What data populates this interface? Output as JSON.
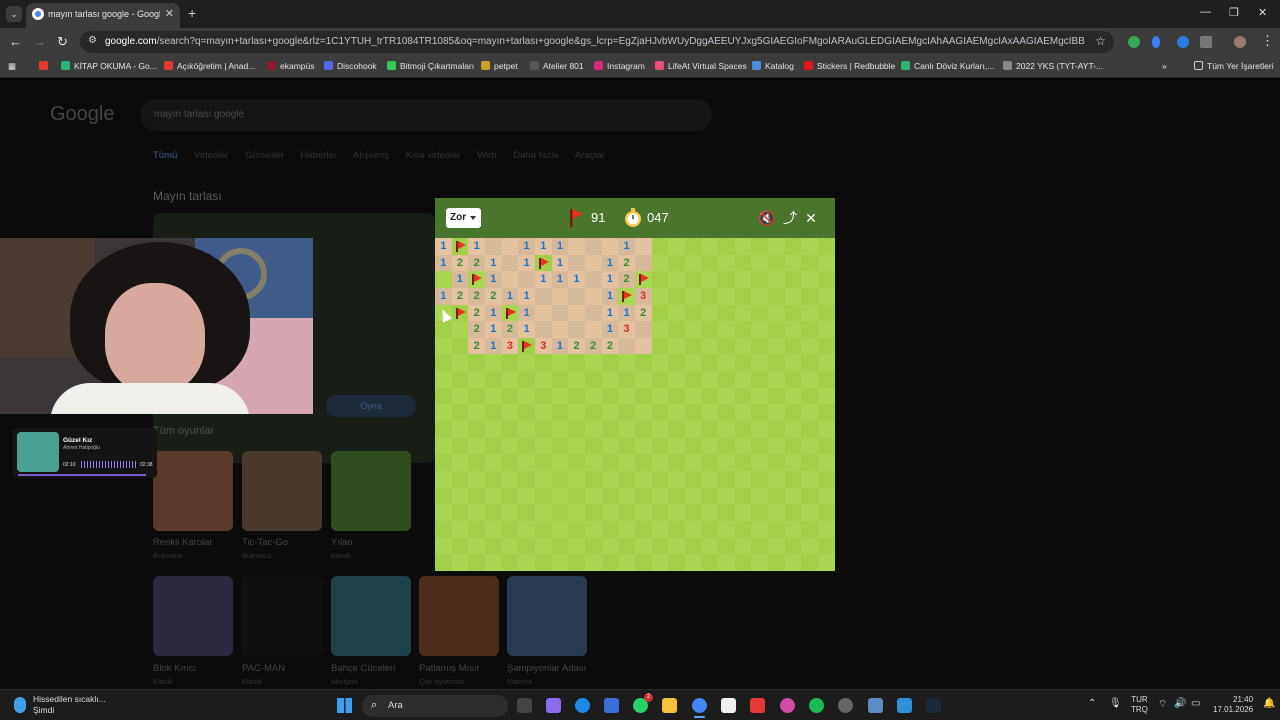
{
  "browser": {
    "tab_title": "mayın tarlası google - Google'da Ara",
    "url_host": "google.com",
    "url_rest": "/search?q=mayın+tarlası+google&rlz=1C1YTUH_trTR1084TR1085&oq=mayın+tarlası+google&gs_lcrp=EgZjaHJvbWUyDggAEEUYJxg5GIAEGIoFMgoIARAuGLEDGIAEMgcIAhAAGIAEMgcIAxAAGIAEMgcIBBAAGIAEMgcIBRAAGI..."
  },
  "bookmarks": [
    {
      "label": "KİTAP OKUMA - Go...",
      "color": "#e53935"
    },
    {
      "label": "Açıköğretim | Anad...",
      "color": "#e53935"
    },
    {
      "label": "ekampüs",
      "color": "#8e1f2a"
    },
    {
      "label": "Discohook",
      "color": "#5865f2"
    },
    {
      "label": "Bitmoji Çıkartmaları",
      "color": "#34c759"
    },
    {
      "label": "petpet",
      "color": "#c9a227"
    },
    {
      "label": "Atelier 801",
      "color": "#222222"
    },
    {
      "label": "Instagram",
      "color": "#d6297b"
    },
    {
      "label": "LifeAt Virtual Spaces",
      "color": "#e94e77"
    },
    {
      "label": "Katalog",
      "color": "#4a90d9"
    },
    {
      "label": "Stickers | Redbubble",
      "color": "#e41321"
    },
    {
      "label": "Canlı Döviz Kurları,...",
      "color": "#2bb673"
    },
    {
      "label": "2022 YKS (TYT-AYT-...",
      "color": "#888888"
    }
  ],
  "bookmarks_all": "Tüm Yer İşaretleri",
  "google": {
    "logo": "Google",
    "query": "mayın tarlası google",
    "tabs": [
      "Tümü",
      "Videolar",
      "Görseller",
      "Haberler",
      "Alışveriş",
      "Kısa videolar",
      "Web",
      "Daha fazla",
      "Araçlar"
    ],
    "section_title": "Mayın tarlası",
    "play_label": "Oyna",
    "all_games": "Tüm oyunlar",
    "games": [
      {
        "name": "Renkli Karolar",
        "sub": "Bulmaca",
        "color": "#5a3a2a"
      },
      {
        "name": "Tic-Tac-Go",
        "sub": "Bulmaca",
        "color": "#4a3a2e"
      },
      {
        "name": "Yılan",
        "sub": "Klasik",
        "color": "#2f4d1f"
      },
      {
        "name": "Blok Kırıcı",
        "sub": "Klasik",
        "color": "#2e2740"
      },
      {
        "name": "PAC-MAN",
        "sub": "Klasik",
        "color": "#101010"
      },
      {
        "name": "Bahçe Cüceleri",
        "sub": "Aksiyon",
        "color": "#1f4048"
      },
      {
        "name": "Patlamış Mısır",
        "sub": "Çok oyunculu",
        "color": "#4d2c1a"
      },
      {
        "name": "Şampiyonlar Adası",
        "sub": "Macera",
        "color": "#2a3a4e"
      }
    ]
  },
  "music": {
    "title": "Güzel Kız",
    "artist": "Ahmet Hatipoğlu",
    "elapsed": "02:10",
    "total": "02:38"
  },
  "minesweeper": {
    "difficulty": "Zor",
    "flags_left": "91",
    "time": "047",
    "board": [
      "1F1..111...1",
      "1221.1F1..12",
      ".1F1..111.12F",
      "122211....1F3",
      ".F21F1....112",
      "..2121....13",
      "..213F31222"
    ],
    "revealed_mask": [
      "1111111111111",
      "1111111111111",
      "0111111111111",
      "1111111111111",
      "0111111111111",
      "0011111111111",
      "0011111111111"
    ],
    "colors": {
      "1": "#1976d2",
      "2": "#388e3c",
      "3": "#d32f2f"
    }
  },
  "taskbar": {
    "weather_title": "Hissedilen sıcaklı...",
    "weather_sub": "Şimdi",
    "search_label": "Ara",
    "notification_count": "2",
    "lang_line1": "TUR",
    "lang_line2": "TRQ",
    "time": "21:40",
    "date": "17.01.2026"
  }
}
